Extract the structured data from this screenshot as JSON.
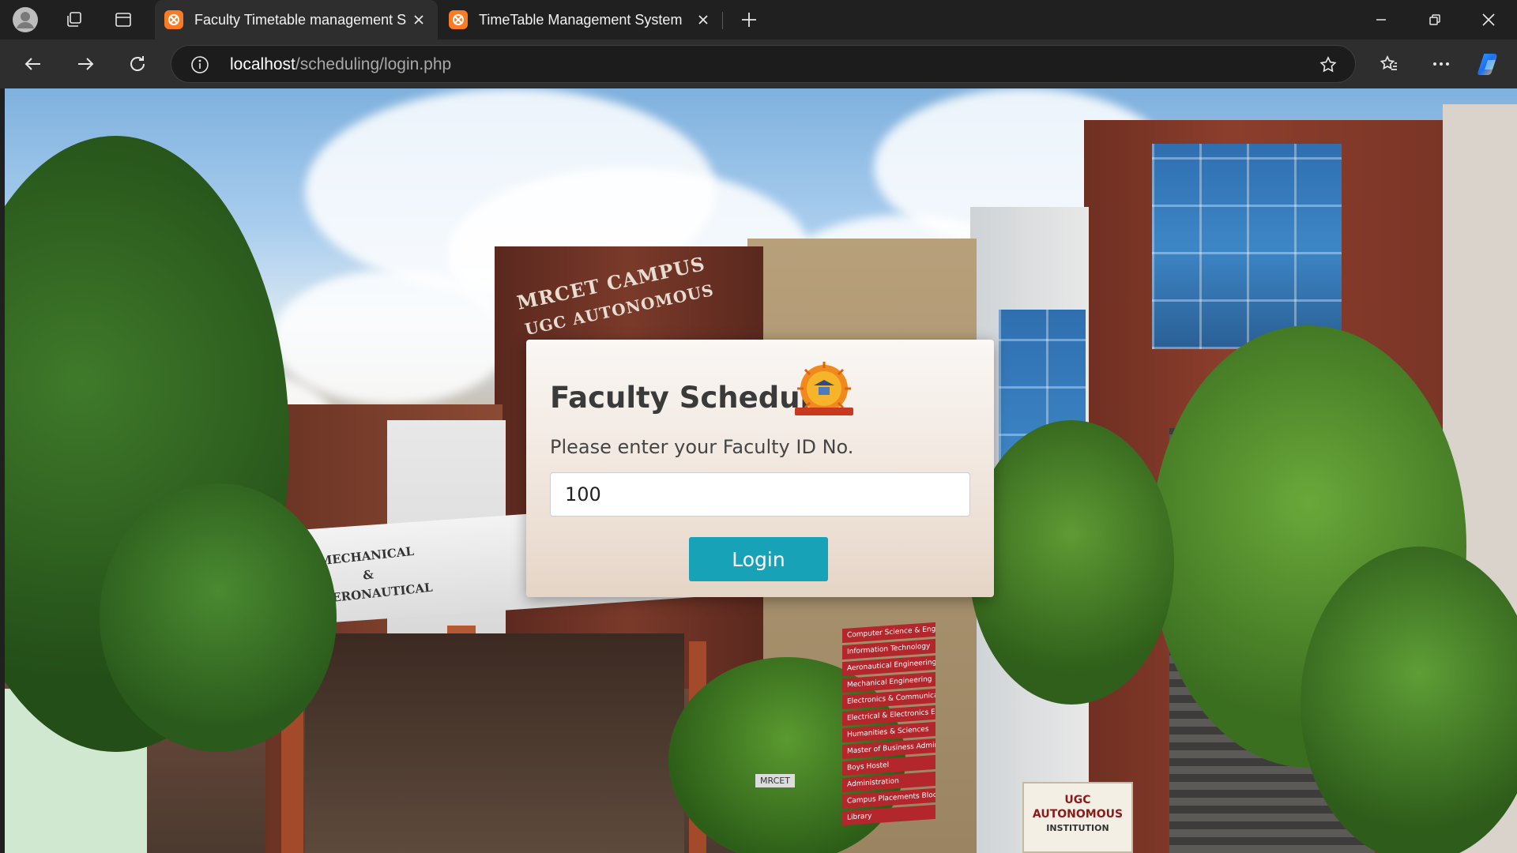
{
  "browser": {
    "tabs": [
      {
        "label": "Faculty Timetable management Sy",
        "active": true
      },
      {
        "label": "TimeTable Management System",
        "active": false
      }
    ],
    "url_host": "localhost",
    "url_path": "/scheduling/login.php"
  },
  "scene": {
    "campus_sign_line1": "MRCET CAMPUS",
    "campus_sign_line2": "UGC AUTONOMOUS",
    "block_sign_line1": "MECHANICAL",
    "block_sign_line2": "&",
    "block_sign_line3": "AERONAUTICAL",
    "signboard_items": [
      "Computer Science & Engineering",
      "Information Technology",
      "Aeronautical Engineering",
      "Mechanical Engineering",
      "Electronics & Communication Engineering",
      "Electrical & Electronics Engineering",
      "Humanities & Sciences",
      "Master of Business Administration",
      "Boys Hostel",
      "Administration",
      "Campus Placements Block",
      "Library"
    ],
    "ugc_line1": "UGC AUTONOMOUS",
    "ugc_line2": "INSTITUTION",
    "mrcet_label": "MRCET"
  },
  "login": {
    "title": "Faculty Schedule",
    "prompt": "Please enter your Faculty ID No.",
    "faculty_id_value": "100",
    "button_label": "Login",
    "accent_color": "#17a2b8"
  }
}
